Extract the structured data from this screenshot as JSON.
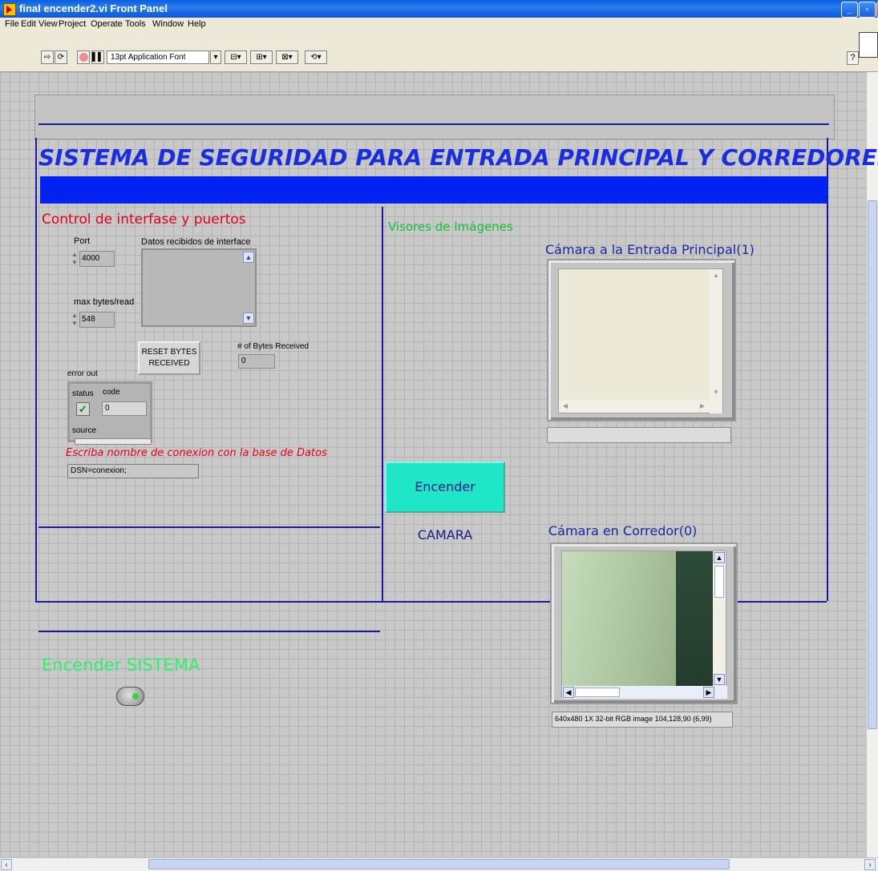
{
  "window": {
    "title": "final encender2.vi Front Panel"
  },
  "menu": [
    "File",
    "Edit",
    "View",
    "Project",
    "Operate",
    "Tools",
    "Window",
    "Help"
  ],
  "toolbar": {
    "font": "13pt Application Font"
  },
  "panel": {
    "main_title": "SISTEMA DE SEGURIDAD PARA  ENTRADA PRINCIPAL Y CORREDORES",
    "control_section": "Control de interfase y puertos",
    "port_label": "Port",
    "port_value": "4000",
    "datos_label": "Datos recibidos de interface",
    "max_bytes_label": "max bytes/read",
    "max_bytes_value": "548",
    "reset_button": "RESET BYTES RECEIVED",
    "bytes_received_label": "# of Bytes Received",
    "bytes_received_value": "0",
    "error_out_label": "error out",
    "status_label": "status",
    "code_label": "code",
    "code_value": "0",
    "source_label": "source",
    "dsn_label": "Escriba nombre de conexion con la base de Datos",
    "dsn_value": "DSN=conexion;",
    "visores_label": "Visores de Imágenes",
    "camera1_title": "Cámara a la Entrada Principal(1)",
    "camara_button": "Encender CAMARA",
    "camera0_title": "Cámara en Corredor(0)",
    "camera0_info": "640x480 1X 32-bit RGB image 104,128,90   (6,99)",
    "sistema_label": "Encender SISTEMA"
  }
}
